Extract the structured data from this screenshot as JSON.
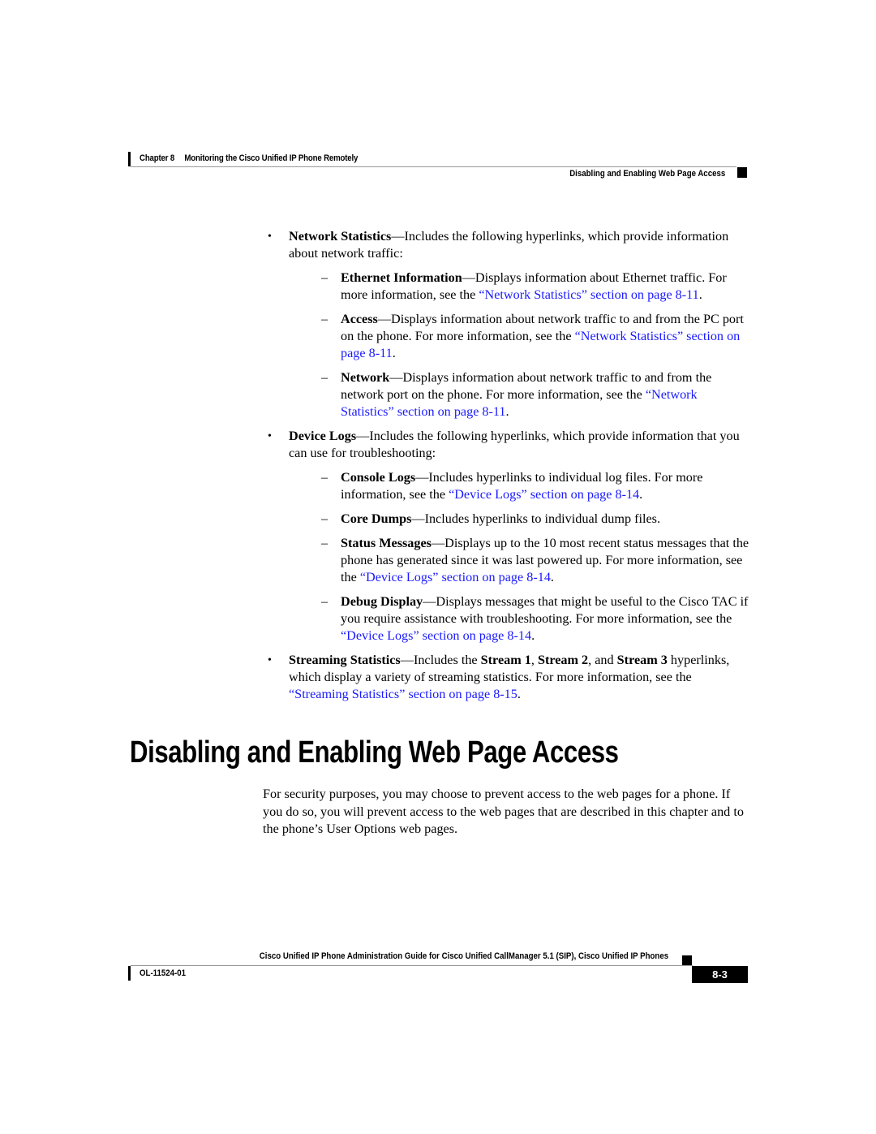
{
  "header": {
    "chapter_label": "Chapter 8",
    "chapter_title": "Monitoring the Cisco Unified IP Phone Remotely",
    "section_title": "Disabling and Enabling Web Page Access"
  },
  "bullets": [
    {
      "term": "Network Statistics",
      "text": "—Includes the following hyperlinks, which provide information about network traffic:",
      "items": [
        {
          "term": "Ethernet Information",
          "text": "—Displays information about Ethernet traffic. For more information, see the ",
          "link": "“Network Statistics” section on page 8-11",
          "after": "."
        },
        {
          "term": "Access",
          "text": "—Displays information about network traffic to and from the PC port on the phone. For more information, see the ",
          "link": "“Network Statistics” section on page 8-11",
          "after": "."
        },
        {
          "term": "Network",
          "text": "—Displays information about network traffic to and from the network port on the phone. For more information, see the ",
          "link": "“Network Statistics” section on page 8-11",
          "after": "."
        }
      ]
    },
    {
      "term": "Device Logs",
      "text": "—Includes the following hyperlinks, which provide information that you can use for troubleshooting:",
      "items": [
        {
          "term": "Console Logs",
          "text": "—Includes hyperlinks to individual log files. For more information, see the ",
          "link": "“Device Logs” section on page 8-14",
          "after": "."
        },
        {
          "term": "Core Dumps",
          "text": "—Includes hyperlinks to individual dump files.",
          "link": "",
          "after": ""
        },
        {
          "term": "Status Messages",
          "text": "—Displays up to the 10 most recent status messages that the phone has generated since it was last powered up. For more information, see the ",
          "link": "“Device Logs” section on page 8-14",
          "after": "."
        },
        {
          "term": "Debug Display",
          "text": "—Displays messages that might be useful to the Cisco TAC if you require assistance with troubleshooting. For more information, see the ",
          "link": "“Device Logs” section on page 8-14",
          "after": "."
        }
      ]
    },
    {
      "term": "Streaming Statistics",
      "text_parts": [
        "—Includes the ",
        "Stream 1",
        ", ",
        "Stream 2",
        ", and ",
        "Stream 3",
        " hyperlinks, which display a variety of streaming statistics. For more information, see the "
      ],
      "link": "“Streaming Statistics” section on page 8-15",
      "after": "."
    }
  ],
  "section": {
    "heading": "Disabling and Enabling Web Page Access",
    "paragraph": "For security purposes, you may choose to prevent access to the web pages for a phone. If you do so, you will prevent access to the web pages that are described in this chapter and to the phone’s User Options web pages."
  },
  "footer": {
    "book_title": "Cisco Unified IP Phone Administration Guide for Cisco Unified CallManager 5.1 (SIP), Cisco Unified IP Phones",
    "doc_number": "OL-11524-01",
    "page_number": "8-3"
  },
  "colors": {
    "link": "#1a1aff",
    "text": "#000000"
  }
}
